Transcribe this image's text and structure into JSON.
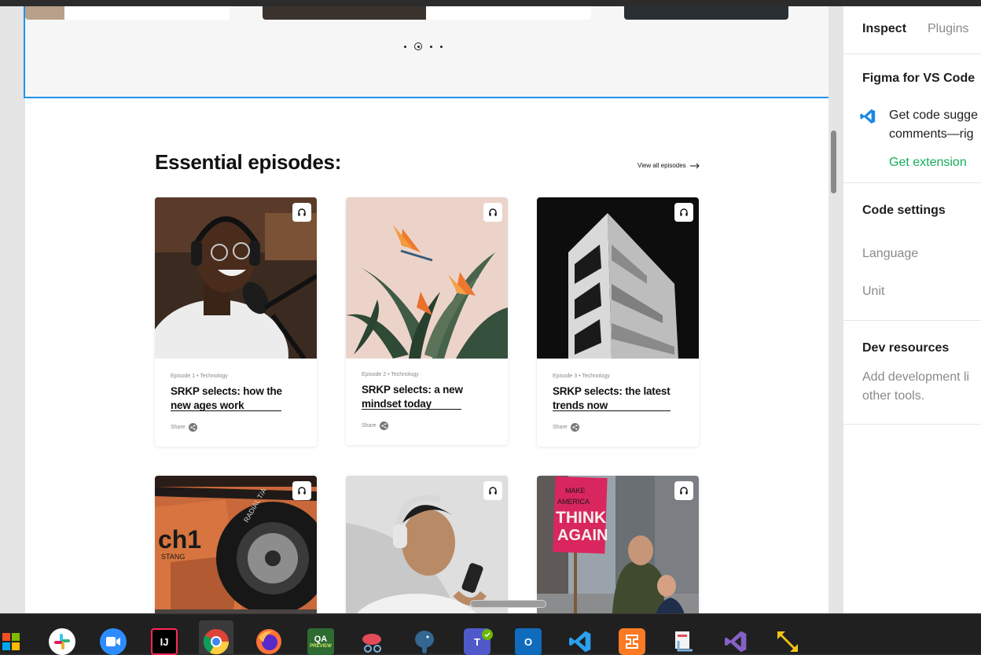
{
  "essential": {
    "title": "Essential episodes:",
    "view_all": "View all episodes"
  },
  "cards": [
    {
      "meta": "Episode 1 • Technology",
      "title": "SRKP selects: how the new ages work",
      "share": "Share"
    },
    {
      "meta": "Episode 2 • Technology",
      "title": "SRKP selects: a new mindset today",
      "share": "Share"
    },
    {
      "meta": "Episode 3 • Technology",
      "title": "SRKP selects: the latest trends now",
      "share": "Share"
    }
  ],
  "carousel": {
    "dot_count": 4,
    "active_index": 1
  },
  "poster": {
    "line1": "MAKE",
    "line2": "AMERICA",
    "line3": "THINK",
    "line4": "AGAIN"
  },
  "car_text": {
    "badge": "ch1",
    "sub": "STANG",
    "tire": "RADIAL T/A"
  },
  "panel": {
    "tabs": [
      "Inspect",
      "Plugins"
    ],
    "figma_vscode": {
      "heading": "Figma for VS Code",
      "desc_line1": "Get code sugge",
      "desc_line2": "comments—rig",
      "link": "Get extension"
    },
    "code_settings": {
      "heading": "Code settings",
      "language": "Language",
      "unit": "Unit"
    },
    "dev_resources": {
      "heading": "Dev resources",
      "line1": "Add development li",
      "line2": "other tools."
    }
  },
  "taskbar": {
    "apps": [
      "windows-start",
      "slack",
      "zoom",
      "intellij",
      "chrome",
      "firefox",
      "qa-preview",
      "snipping-tool",
      "postgresql",
      "teams",
      "outlook",
      "vscode",
      "xampp",
      "snip-sketch",
      "visual-studio",
      "resize-tool"
    ],
    "active": "chrome",
    "labels": {
      "intellij": "IJ",
      "qa": "QA",
      "qa_sub": "PREVIEW",
      "outlook": "O"
    }
  },
  "colors": {
    "selection": "#1e93ea",
    "link_green": "#14ae5c",
    "taskbar": "#202020"
  }
}
